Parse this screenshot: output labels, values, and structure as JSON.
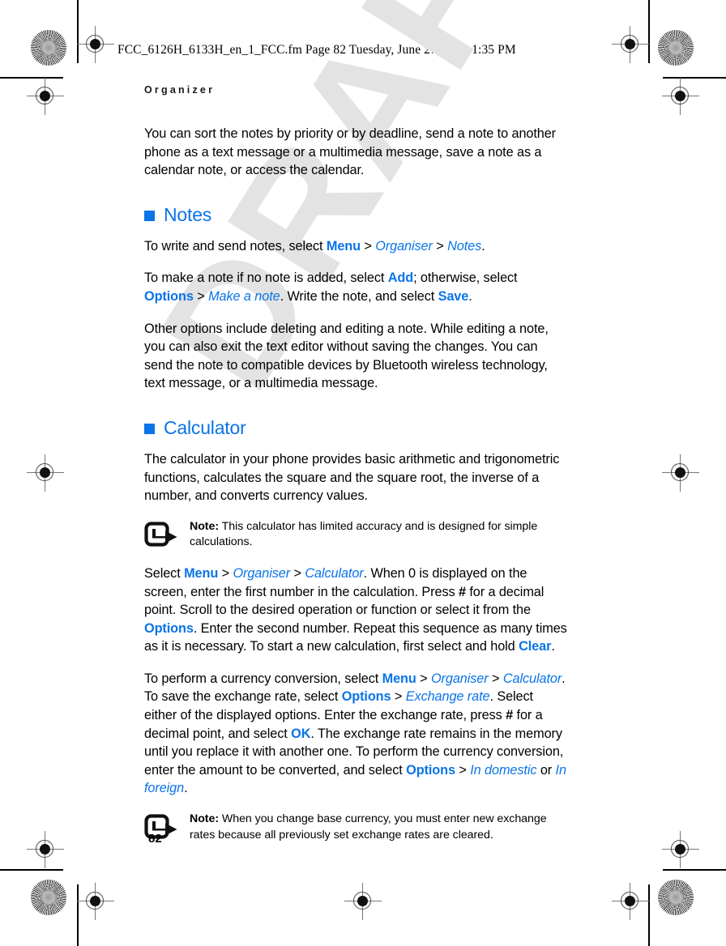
{
  "print_marks": {
    "file_slug": "FCC_6126H_6133H_en_1_FCC.fm  Page 82  Tuesday, June 27, 2006  1:35 PM",
    "registration_icon": "registration-target",
    "star_target_icon": "star-burst-target"
  },
  "watermark": {
    "text": "DRAFT",
    "color": "#e3e3e3"
  },
  "running_head": "Organizer",
  "accent_color": "#0a74e8",
  "intro": {
    "text": "You can sort the notes by priority or by deadline, send a note to another phone as a text message or a multimedia message, save a note as a calendar note, or access the calendar."
  },
  "sections": [
    {
      "id": "notes",
      "heading": "Notes",
      "paragraphs": [
        {
          "id": "notes-p1",
          "runs": [
            {
              "t": "To write and send notes, select ",
              "s": "plain"
            },
            {
              "t": "Menu",
              "s": "cmd"
            },
            {
              "t": " > ",
              "s": "plain"
            },
            {
              "t": "Organiser",
              "s": "menu"
            },
            {
              "t": " > ",
              "s": "plain"
            },
            {
              "t": "Notes",
              "s": "menu"
            },
            {
              "t": ".",
              "s": "plain"
            }
          ]
        },
        {
          "id": "notes-p2",
          "runs": [
            {
              "t": "To make a note if no note is added, select ",
              "s": "plain"
            },
            {
              "t": "Add",
              "s": "cmd"
            },
            {
              "t": "; otherwise, select ",
              "s": "plain"
            },
            {
              "t": "Options",
              "s": "cmd"
            },
            {
              "t": " > ",
              "s": "plain"
            },
            {
              "t": "Make a note",
              "s": "menu"
            },
            {
              "t": ". Write the note, and select ",
              "s": "plain"
            },
            {
              "t": "Save",
              "s": "cmd"
            },
            {
              "t": ".",
              "s": "plain"
            }
          ]
        },
        {
          "id": "notes-p3",
          "runs": [
            {
              "t": "Other options include deleting and editing a note. While editing a note, you can also exit the text editor without saving the changes. You can send the note to compatible devices by Bluetooth wireless technology, text message, or a multimedia message.",
              "s": "plain"
            }
          ]
        }
      ]
    },
    {
      "id": "calculator",
      "heading": "Calculator",
      "paragraphs": [
        {
          "id": "calc-p1",
          "runs": [
            {
              "t": "The calculator in your phone provides basic arithmetic and trigonometric functions, calculates the square and the square root, the inverse of a number, and converts currency values.",
              "s": "plain"
            }
          ]
        }
      ]
    }
  ],
  "notes_callouts": [
    {
      "id": "note-calculator-accuracy",
      "label": "Note:",
      "text": " This calculator has limited accuracy and is designed for simple calculations.",
      "icon": "note-arrow-icon"
    },
    {
      "id": "note-base-currency",
      "label": "Note:",
      "text": " When you change base currency, you must enter new exchange rates because all previously set exchange rates are cleared.",
      "icon": "note-arrow-icon"
    }
  ],
  "calc_body": {
    "select_para": {
      "id": "calc-select",
      "runs": [
        {
          "t": "Select ",
          "s": "plain"
        },
        {
          "t": "Menu",
          "s": "cmd"
        },
        {
          "t": " > ",
          "s": "plain"
        },
        {
          "t": "Organiser",
          "s": "menu"
        },
        {
          "t": " > ",
          "s": "plain"
        },
        {
          "t": "Calculator",
          "s": "menu"
        },
        {
          "t": ". When 0 is displayed on the screen, enter the first number in the calculation. Press ",
          "s": "plain"
        },
        {
          "t": "#",
          "s": "bold"
        },
        {
          "t": " for a decimal point. Scroll to the desired operation or function or select it from the ",
          "s": "plain"
        },
        {
          "t": "Options",
          "s": "cmd"
        },
        {
          "t": ". Enter the second number. Repeat this sequence as many times as it is necessary. To start a new calculation, first select and hold ",
          "s": "plain"
        },
        {
          "t": "Clear",
          "s": "cmd"
        },
        {
          "t": ".",
          "s": "plain"
        }
      ]
    },
    "currency_para": {
      "id": "calc-currency",
      "runs": [
        {
          "t": "To perform a currency conversion, select ",
          "s": "plain"
        },
        {
          "t": "Menu",
          "s": "cmd"
        },
        {
          "t": " > ",
          "s": "plain"
        },
        {
          "t": "Organiser",
          "s": "menu"
        },
        {
          "t": " > ",
          "s": "plain"
        },
        {
          "t": "Calculator",
          "s": "menu"
        },
        {
          "t": ". To save the exchange rate, select ",
          "s": "plain"
        },
        {
          "t": "Options",
          "s": "cmd"
        },
        {
          "t": " > ",
          "s": "plain"
        },
        {
          "t": "Exchange rate",
          "s": "menu"
        },
        {
          "t": ". Select either of the displayed options. Enter the exchange rate, press ",
          "s": "plain"
        },
        {
          "t": "#",
          "s": "bold"
        },
        {
          "t": " for a decimal point, and select ",
          "s": "plain"
        },
        {
          "t": "OK",
          "s": "cmd"
        },
        {
          "t": ". The exchange rate remains in the memory until you replace it with another one. To perform the currency conversion, enter the amount to be converted, and select ",
          "s": "plain"
        },
        {
          "t": "Options",
          "s": "cmd"
        },
        {
          "t": " > ",
          "s": "plain"
        },
        {
          "t": "In domestic",
          "s": "menu"
        },
        {
          "t": " or ",
          "s": "plain"
        },
        {
          "t": "In foreign",
          "s": "menu"
        },
        {
          "t": ".",
          "s": "plain"
        }
      ]
    }
  },
  "footer": {
    "page_number": "82"
  }
}
